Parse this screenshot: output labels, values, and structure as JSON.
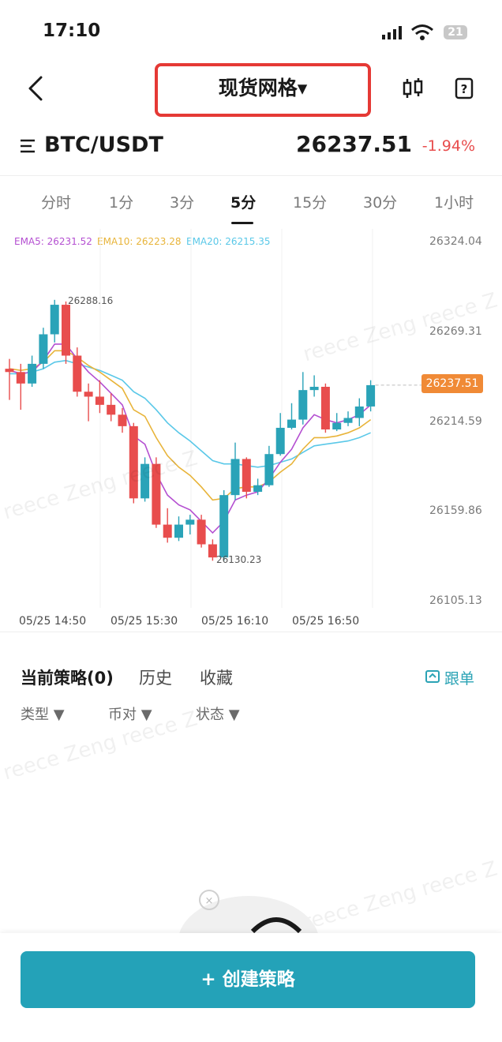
{
  "status_bar": {
    "time": "17:10",
    "battery": "21"
  },
  "nav": {
    "title": "现货网格▾"
  },
  "pair": {
    "name": "BTC/USDT",
    "price": "26237.51",
    "change": "-1.94%"
  },
  "timeframes": [
    "分时",
    "1分",
    "3分",
    "5分",
    "15分",
    "30分",
    "1小时"
  ],
  "active_timeframe": "5分",
  "chart": {
    "ema": {
      "ema5": "EMA5: 26231.52",
      "ema10": "EMA10: 26223.28",
      "ema20": "EMA20: 26215.35"
    },
    "y_ticks": [
      "26324.04",
      "26269.31",
      "26214.59",
      "26159.86",
      "26105.13"
    ],
    "x_ticks": [
      "05/25 14:50",
      "05/25 15:30",
      "05/25 16:10",
      "05/25 16:50"
    ],
    "current_price_label": "26237.51",
    "high_label": "26288.16",
    "low_label": "26130.23",
    "colors": {
      "up": "#2aa3b8",
      "down": "#e84d4d",
      "ema5": "#b44fd1",
      "ema10": "#e8b43a",
      "ema20": "#5ac8e8"
    }
  },
  "chart_data": {
    "type": "candlestick",
    "ylim": [
      26105.13,
      26324.04
    ],
    "candles": [
      {
        "o": 26247,
        "c": 26245,
        "h": 26253,
        "l": 26228
      },
      {
        "o": 26245,
        "c": 26238,
        "h": 26250,
        "l": 26222
      },
      {
        "o": 26238,
        "c": 26250,
        "h": 26255,
        "l": 26236
      },
      {
        "o": 26250,
        "c": 26268,
        "h": 26272,
        "l": 26247
      },
      {
        "o": 26268,
        "c": 26286,
        "h": 26289,
        "l": 26263
      },
      {
        "o": 26286,
        "c": 26255,
        "h": 26288,
        "l": 26250
      },
      {
        "o": 26255,
        "c": 26233,
        "h": 26260,
        "l": 26230
      },
      {
        "o": 26233,
        "c": 26230,
        "h": 26238,
        "l": 26215
      },
      {
        "o": 26230,
        "c": 26225,
        "h": 26240,
        "l": 26220
      },
      {
        "o": 26225,
        "c": 26219,
        "h": 26232,
        "l": 26215
      },
      {
        "o": 26219,
        "c": 26212,
        "h": 26223,
        "l": 26208
      },
      {
        "o": 26212,
        "c": 26168,
        "h": 26214,
        "l": 26165
      },
      {
        "o": 26168,
        "c": 26189,
        "h": 26193,
        "l": 26166
      },
      {
        "o": 26189,
        "c": 26152,
        "h": 26193,
        "l": 26150
      },
      {
        "o": 26152,
        "c": 26144,
        "h": 26162,
        "l": 26141
      },
      {
        "o": 26144,
        "c": 26152,
        "h": 26157,
        "l": 26142
      },
      {
        "o": 26152,
        "c": 26155,
        "h": 26158,
        "l": 26146
      },
      {
        "o": 26155,
        "c": 26140,
        "h": 26158,
        "l": 26138
      },
      {
        "o": 26140,
        "c": 26132,
        "h": 26143,
        "l": 26130
      },
      {
        "o": 26132,
        "c": 26170,
        "h": 26173,
        "l": 26130
      },
      {
        "o": 26170,
        "c": 26192,
        "h": 26202,
        "l": 26167
      },
      {
        "o": 26192,
        "c": 26172,
        "h": 26193,
        "l": 26168
      },
      {
        "o": 26172,
        "c": 26176,
        "h": 26180,
        "l": 26170
      },
      {
        "o": 26176,
        "c": 26195,
        "h": 26200,
        "l": 26175
      },
      {
        "o": 26195,
        "c": 26211,
        "h": 26220,
        "l": 26194
      },
      {
        "o": 26211,
        "c": 26216,
        "h": 26226,
        "l": 26210
      },
      {
        "o": 26216,
        "c": 26234,
        "h": 26245,
        "l": 26213
      },
      {
        "o": 26234,
        "c": 26236,
        "h": 26243,
        "l": 26230
      },
      {
        "o": 26236,
        "c": 26210,
        "h": 26238,
        "l": 26208
      },
      {
        "o": 26210,
        "c": 26214,
        "h": 26220,
        "l": 26209
      },
      {
        "o": 26214,
        "c": 26217,
        "h": 26221,
        "l": 26212
      },
      {
        "o": 26217,
        "c": 26224,
        "h": 26229,
        "l": 26212
      },
      {
        "o": 26224,
        "c": 26237,
        "h": 26240,
        "l": 26221
      }
    ],
    "ema5": [
      26246,
      26244,
      26245,
      26252,
      26262,
      26262,
      26253,
      26245,
      26239,
      26232,
      26225,
      26206,
      26201,
      26183,
      26170,
      26164,
      26161,
      26154,
      26147,
      26154,
      26167,
      26170,
      26172,
      26180,
      26190,
      26198,
      26211,
      26219,
      26216,
      26214,
      26216,
      26219,
      26225
    ],
    "ema10": [
      26247,
      26246,
      26247,
      26251,
      26258,
      26258,
      26254,
      26249,
      26245,
      26240,
      26235,
      26222,
      26218,
      26205,
      26194,
      26187,
      26182,
      26175,
      26167,
      26168,
      26174,
      26175,
      26175,
      26178,
      26184,
      26189,
      26198,
      26205,
      26205,
      26206,
      26208,
      26211,
      26216
    ],
    "ema20": [
      26244,
      26244,
      26245,
      26247,
      26251,
      26252,
      26250,
      26248,
      26246,
      26243,
      26240,
      26233,
      26229,
      26222,
      26214,
      26208,
      26203,
      26197,
      26191,
      26189,
      26189,
      26188,
      26187,
      26188,
      26190,
      26192,
      26196,
      26200,
      26201,
      26202,
      26203,
      26205,
      26208
    ]
  },
  "strategy": {
    "tabs": [
      "当前策略(0)",
      "历史",
      "收藏"
    ],
    "follow": "跟单",
    "filters": [
      "类型 ▼",
      "币对 ▼",
      "状态 ▼"
    ],
    "create_button": "创建策略"
  },
  "watermark": "reece Zeng reece Z"
}
